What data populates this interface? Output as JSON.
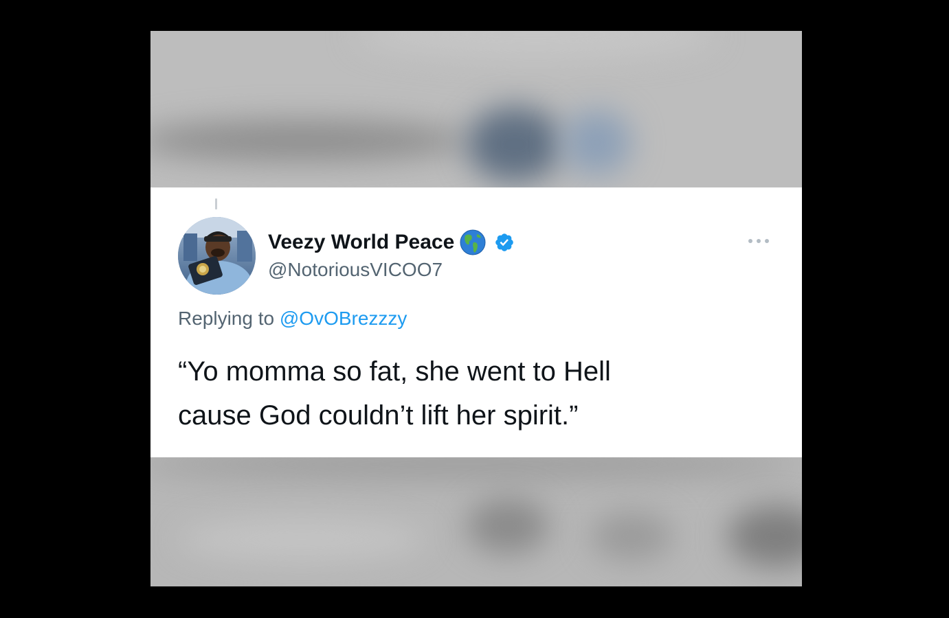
{
  "tweet": {
    "display_name": "Veezy World Peace",
    "handle": "@NotoriousVICOO7",
    "replying_prefix": "Replying to",
    "replying_to": "@OvOBrezzzy",
    "text_line1": "“Yo momma so fat, she went to Hell",
    "text_line2": "cause God couldn’t lift her spirit.”",
    "name_emoji_icon": "globe-americas-icon",
    "badge_icon": "verified-badge-icon",
    "more_icon": "more-options-icon"
  },
  "colors": {
    "background": "#000000",
    "card": "#ffffff",
    "blurred_area": "#bdbdbd",
    "name": "#0f1419",
    "secondary_text": "#536471",
    "mention": "#1d9bf0",
    "verified": "#1d9bf0"
  }
}
